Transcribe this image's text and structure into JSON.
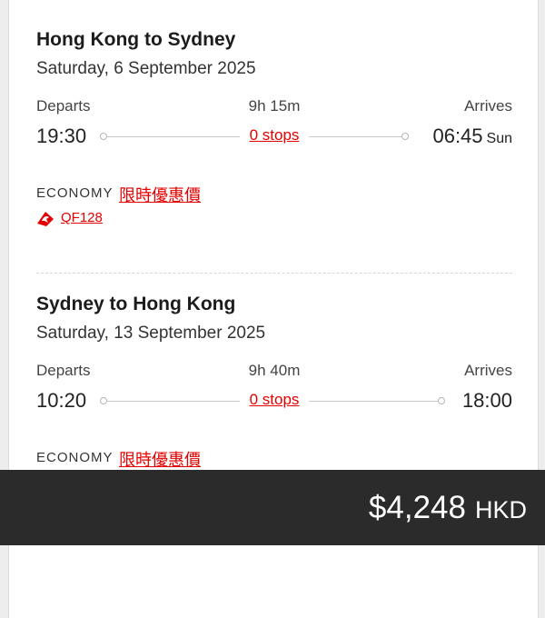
{
  "segments": [
    {
      "title": "Hong Kong to Sydney",
      "date": "Saturday, 6 September 2025",
      "departs_label": "Departs",
      "duration": "9h 15m",
      "arrives_label": "Arrives",
      "depart_time": "19:30",
      "stops": "0 stops",
      "arrive_time": "06:45",
      "arrive_day": "Sun",
      "cabin": "ECONOMY",
      "fare_tag": "限時優惠價",
      "flight_number": "QF128"
    },
    {
      "title": "Sydney to Hong Kong",
      "date": "Saturday, 13 September 2025",
      "departs_label": "Departs",
      "duration": "9h 40m",
      "arrives_label": "Arrives",
      "depart_time": "10:20",
      "stops": "0 stops",
      "arrive_time": "18:00",
      "cabin": "ECONOMY",
      "fare_tag": "限時優惠價"
    }
  ],
  "total": {
    "amount": "$4,248",
    "currency": "HKD"
  },
  "icons": {
    "airline_logo": "qantas-kangaroo-icon"
  },
  "colors": {
    "accent_red": "#e40000",
    "price_bar": "#2b2b2b"
  }
}
